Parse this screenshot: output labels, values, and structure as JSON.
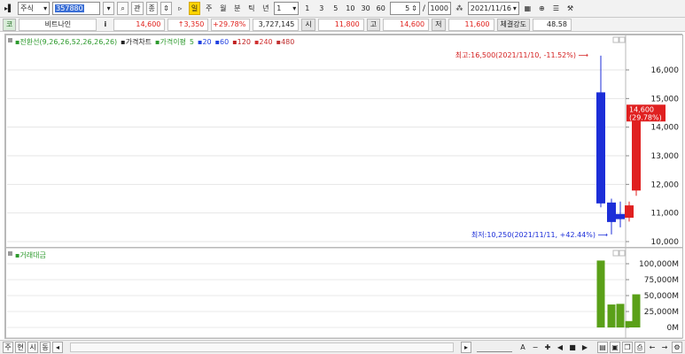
{
  "toolbar": {
    "market_select": "주식",
    "code_value": "357880",
    "icon_names": [
      "arrow-right-icon",
      "dropdown-icon",
      "search-icon",
      "grid-icon",
      "updown-icon"
    ],
    "btn_gwan": "관",
    "btn_bo": "종",
    "period_buttons": [
      "일",
      "주",
      "월",
      "분",
      "틱",
      "년"
    ],
    "interval_value": "1",
    "interval_options": [
      "1",
      "3",
      "5",
      "10",
      "30",
      "60"
    ],
    "count_value": "5",
    "range_separator": "/",
    "range_value": "1000",
    "date_value": "2021/11/16"
  },
  "info": {
    "market_badge": "코",
    "name": "비트나인",
    "info_icon": "i",
    "price": "14,600",
    "change": "↑3,350",
    "change_pct": "+29.78%",
    "volume": "3,727,145",
    "open_label": "시",
    "open": "11,800",
    "high_label": "고",
    "high": "14,600",
    "low_label": "저",
    "low": "11,600",
    "strength_label": "체결강도",
    "strength": "48.58"
  },
  "legend": {
    "ma_line": "전환선(9,26,26,52,26,26,26)",
    "price_chart": "가격차트",
    "price_ma": "가격이평",
    "ma_periods": [
      "5",
      "20",
      "60",
      "120",
      "240",
      "480"
    ],
    "ma_colors": [
      "#2d9a2d",
      "#2040e0",
      "#2040e0",
      "#c02020",
      "#d03030",
      "#c03030"
    ]
  },
  "volume_pane": {
    "label": "거래대금"
  },
  "annotations": {
    "high": "최고:16,500(2021/11/10, -11.52%)",
    "low": "최저:10,250(2021/11/11, +42.44%)"
  },
  "current_price_tag": {
    "price": "14,600",
    "pct": "(29.78%)"
  },
  "chart_data": {
    "type": "candlestick",
    "price_axis": {
      "ticks": [
        "16,000",
        "15,000",
        "14,000",
        "13,000",
        "12,000",
        "11,000",
        "10,000"
      ],
      "min": 10000,
      "max": 16000
    },
    "volume_axis": {
      "ticks": [
        "100,000M",
        "75,000M",
        "50,000M",
        "25,000M",
        "0M"
      ],
      "min": 0,
      "max": 100000
    },
    "candles": [
      {
        "open": 15200,
        "high": 16500,
        "low": 11200,
        "close": 11350
      },
      {
        "open": 11350,
        "high": 11500,
        "low": 10250,
        "close": 10700
      },
      {
        "open": 10950,
        "high": 11400,
        "low": 10500,
        "close": 10800
      },
      {
        "open": 10850,
        "high": 11400,
        "low": 10700,
        "close": 11250
      },
      {
        "open": 11800,
        "high": 14600,
        "low": 11600,
        "close": 14600
      }
    ],
    "volumes": [
      105000,
      36000,
      37000,
      10000,
      52000
    ],
    "up_color": "#e02020",
    "down_color": "#1c2ed8",
    "volume_color": "#5aa018"
  },
  "statusbar": {
    "buttons": [
      "주",
      "현",
      "시",
      "동"
    ],
    "icons": [
      "chart-icon",
      "save-icon",
      "copy-icon",
      "print-icon"
    ]
  }
}
